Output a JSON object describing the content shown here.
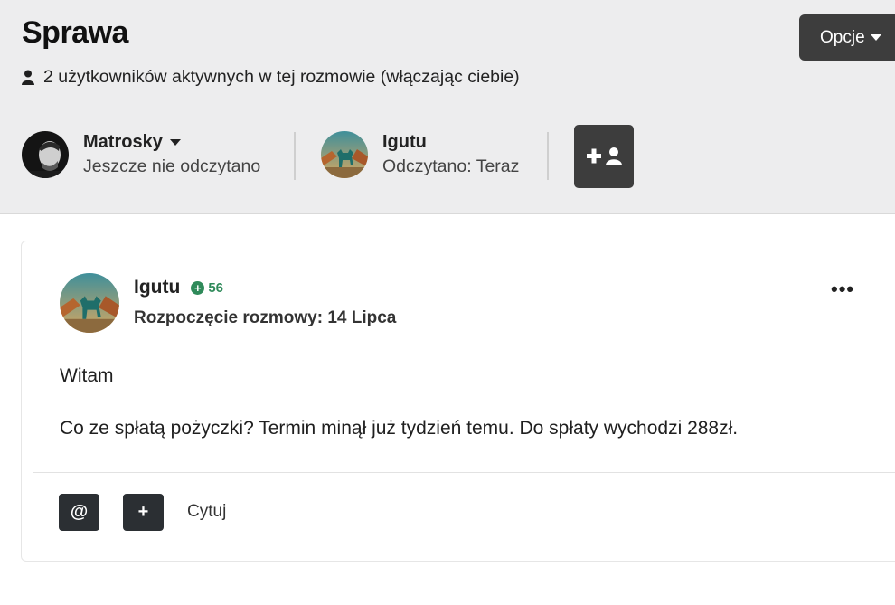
{
  "header": {
    "title": "Sprawa",
    "options_label": "Opcje",
    "active_users_text": "2 użytkowników aktywnych w tej rozmowie (włączając ciebie)"
  },
  "participants": [
    {
      "name": "Matrosky",
      "status": "Jeszcze nie odczytano",
      "has_menu": true
    },
    {
      "name": "Igutu",
      "status": "Odczytano: Teraz",
      "has_menu": false
    }
  ],
  "post": {
    "author": "Igutu",
    "reputation": "56",
    "started": "Rozpoczęcie rozmowy: 14 Lipca",
    "body": [
      "Witam",
      "Co ze spłatą pożyczki? Termin minął już tydzień temu. Do spłaty wychodzi 288zł."
    ],
    "actions": {
      "mention_label": "@",
      "plus_label": "+",
      "quote_label": "Cytuj"
    }
  },
  "icons": [
    "user-icon",
    "caret-down-icon",
    "add-user-icon",
    "plus-circle-icon",
    "ellipsis-icon"
  ],
  "colors": {
    "header_bg": "#ededee",
    "dark_button": "#3d3d3d",
    "reputation_green": "#2f8a5a"
  }
}
